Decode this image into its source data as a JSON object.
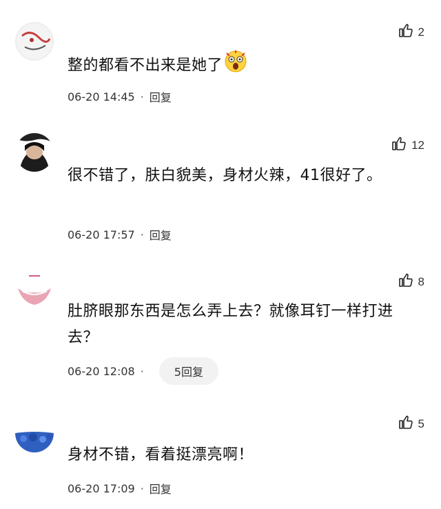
{
  "comments": [
    {
      "text": "整的都看不出来是她了",
      "emoji": "shocked-face-emoji",
      "likes": "2",
      "date": "06-20 14:45",
      "separator": "·",
      "reply": "回复"
    },
    {
      "text": "很不错了，肤白貌美，身材火辣，41很好了。",
      "likes": "12",
      "date": "06-20 17:57",
      "separator": "·",
      "reply": "回复"
    },
    {
      "text": "肚脐眼那东西是怎么弄上去？就像耳钉一样打进去？",
      "likes": "8",
      "date": "06-20 12:08",
      "separator": "·",
      "reply": "5回复"
    },
    {
      "text": "身材不错，看着挺漂亮啊！",
      "likes": "5",
      "date": "06-20 17:09",
      "separator": "·",
      "reply": "回复"
    }
  ],
  "icons": {
    "like": "thumbs-up-icon"
  },
  "colors": {
    "text": "#111111",
    "meta": "#333333",
    "pill_bg": "#f2f2f2"
  }
}
